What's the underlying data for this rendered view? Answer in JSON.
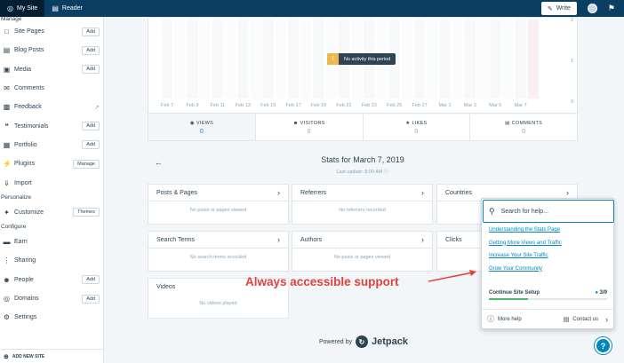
{
  "masterbar": {
    "my_site": "My Site",
    "reader": "Reader",
    "write": "Write"
  },
  "sidebar": {
    "top_section": "Manage",
    "manage": [
      {
        "label": "Site Pages",
        "button": "Add",
        "icon": "page-icon"
      },
      {
        "label": "Blog Posts",
        "button": "Add",
        "icon": "posts-icon"
      },
      {
        "label": "Media",
        "button": "Add",
        "icon": "media-icon"
      },
      {
        "label": "Comments",
        "button": "",
        "icon": "comments-icon"
      },
      {
        "label": "Feedback",
        "button": "",
        "icon": "feedback-icon"
      },
      {
        "label": "Testimonials",
        "button": "Add",
        "icon": "testimonials-icon"
      },
      {
        "label": "Portfolio",
        "button": "Add",
        "icon": "portfolio-icon"
      },
      {
        "label": "Plugins",
        "button": "Manage",
        "icon": "plugins-icon"
      },
      {
        "label": "Import",
        "button": "",
        "icon": "import-icon"
      }
    ],
    "personalize_section": "Personalize",
    "customize": {
      "label": "Customize",
      "button": "Themes"
    },
    "configure_section": "Configure",
    "configure": [
      {
        "label": "Earn",
        "button": "",
        "icon": "earn-icon"
      },
      {
        "label": "Sharing",
        "button": "",
        "icon": "sharing-icon"
      },
      {
        "label": "People",
        "button": "Add",
        "icon": "people-icon"
      },
      {
        "label": "Domains",
        "button": "Add",
        "icon": "domains-icon"
      },
      {
        "label": "Settings",
        "button": "",
        "icon": "settings-icon"
      }
    ],
    "add_new_site": "ADD NEW SITE"
  },
  "chart": {
    "no_activity": "No activity this period",
    "y_ticks": [
      "2",
      "1",
      "0"
    ],
    "x_ticks": [
      "Feb 7",
      "Feb 9",
      "Feb 11",
      "Feb 13",
      "Feb 15",
      "Feb 17",
      "Feb 19",
      "Feb 21",
      "Feb 23",
      "Feb 25",
      "Feb 27",
      "Mar 1",
      "Mar 3",
      "Mar 5",
      "Mar 7"
    ]
  },
  "tabs": [
    {
      "label": "VIEWS",
      "value": "0",
      "icon": "eye-icon"
    },
    {
      "label": "VISITORS",
      "value": "0",
      "icon": "person-icon"
    },
    {
      "label": "LIKES",
      "value": "0",
      "icon": "star-icon"
    },
    {
      "label": "COMMENTS",
      "value": "0",
      "icon": "comment-icon"
    }
  ],
  "stats": {
    "title": "Stats for March 7, 2019",
    "last_update": "Last update: 8:00 AM"
  },
  "modules": {
    "posts_pages": {
      "title": "Posts & Pages",
      "empty": "No posts or pages viewed"
    },
    "referrers": {
      "title": "Referrers",
      "empty": "No referrers recorded"
    },
    "countries": {
      "title": "Countries"
    },
    "search_terms": {
      "title": "Search Terms",
      "empty": "No search terms recorded"
    },
    "authors": {
      "title": "Authors",
      "empty": "No posts or pages viewed"
    },
    "clicks": {
      "title": "Clicks"
    },
    "videos": {
      "title": "Videos",
      "empty": "No videos played"
    }
  },
  "powered_by": {
    "prefix": "Powered by",
    "brand": "Jetpack"
  },
  "help": {
    "search_placeholder": "Search for help...",
    "links": [
      "Understanding the Stats Page",
      "Getting More Views and Traffic",
      "Increase Your Site Traffic",
      "Grow Your Community"
    ],
    "setup_label": "Continue Site Setup",
    "setup_count": "3/9",
    "setup_progress": 0.33,
    "more_help": "More help",
    "contact": "Contact us"
  },
  "annotation": "Always accessible support",
  "colors": {
    "masterbar": "#0a3f63",
    "accent": "#0087be",
    "annotation": "#e2403a",
    "progress": "#4ab866",
    "notice": "#f0b849"
  }
}
